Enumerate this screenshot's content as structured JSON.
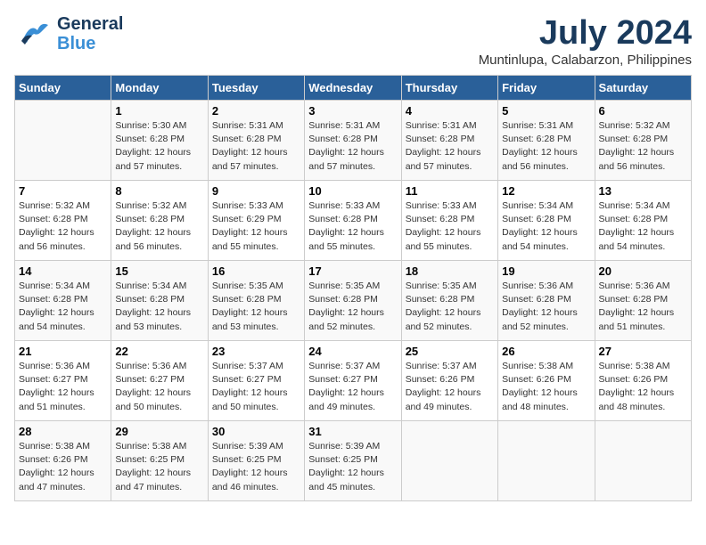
{
  "header": {
    "logo_general": "General",
    "logo_blue": "Blue",
    "main_title": "July 2024",
    "subtitle": "Muntinlupa, Calabarzon, Philippines"
  },
  "days_of_week": [
    "Sunday",
    "Monday",
    "Tuesday",
    "Wednesday",
    "Thursday",
    "Friday",
    "Saturday"
  ],
  "weeks": [
    [
      {
        "day": "",
        "info": ""
      },
      {
        "day": "1",
        "info": "Sunrise: 5:30 AM\nSunset: 6:28 PM\nDaylight: 12 hours\nand 57 minutes."
      },
      {
        "day": "2",
        "info": "Sunrise: 5:31 AM\nSunset: 6:28 PM\nDaylight: 12 hours\nand 57 minutes."
      },
      {
        "day": "3",
        "info": "Sunrise: 5:31 AM\nSunset: 6:28 PM\nDaylight: 12 hours\nand 57 minutes."
      },
      {
        "day": "4",
        "info": "Sunrise: 5:31 AM\nSunset: 6:28 PM\nDaylight: 12 hours\nand 57 minutes."
      },
      {
        "day": "5",
        "info": "Sunrise: 5:31 AM\nSunset: 6:28 PM\nDaylight: 12 hours\nand 56 minutes."
      },
      {
        "day": "6",
        "info": "Sunrise: 5:32 AM\nSunset: 6:28 PM\nDaylight: 12 hours\nand 56 minutes."
      }
    ],
    [
      {
        "day": "7",
        "info": "Sunrise: 5:32 AM\nSunset: 6:28 PM\nDaylight: 12 hours\nand 56 minutes."
      },
      {
        "day": "8",
        "info": "Sunrise: 5:32 AM\nSunset: 6:28 PM\nDaylight: 12 hours\nand 56 minutes."
      },
      {
        "day": "9",
        "info": "Sunrise: 5:33 AM\nSunset: 6:29 PM\nDaylight: 12 hours\nand 55 minutes."
      },
      {
        "day": "10",
        "info": "Sunrise: 5:33 AM\nSunset: 6:28 PM\nDaylight: 12 hours\nand 55 minutes."
      },
      {
        "day": "11",
        "info": "Sunrise: 5:33 AM\nSunset: 6:28 PM\nDaylight: 12 hours\nand 55 minutes."
      },
      {
        "day": "12",
        "info": "Sunrise: 5:34 AM\nSunset: 6:28 PM\nDaylight: 12 hours\nand 54 minutes."
      },
      {
        "day": "13",
        "info": "Sunrise: 5:34 AM\nSunset: 6:28 PM\nDaylight: 12 hours\nand 54 minutes."
      }
    ],
    [
      {
        "day": "14",
        "info": "Sunrise: 5:34 AM\nSunset: 6:28 PM\nDaylight: 12 hours\nand 54 minutes."
      },
      {
        "day": "15",
        "info": "Sunrise: 5:34 AM\nSunset: 6:28 PM\nDaylight: 12 hours\nand 53 minutes."
      },
      {
        "day": "16",
        "info": "Sunrise: 5:35 AM\nSunset: 6:28 PM\nDaylight: 12 hours\nand 53 minutes."
      },
      {
        "day": "17",
        "info": "Sunrise: 5:35 AM\nSunset: 6:28 PM\nDaylight: 12 hours\nand 52 minutes."
      },
      {
        "day": "18",
        "info": "Sunrise: 5:35 AM\nSunset: 6:28 PM\nDaylight: 12 hours\nand 52 minutes."
      },
      {
        "day": "19",
        "info": "Sunrise: 5:36 AM\nSunset: 6:28 PM\nDaylight: 12 hours\nand 52 minutes."
      },
      {
        "day": "20",
        "info": "Sunrise: 5:36 AM\nSunset: 6:28 PM\nDaylight: 12 hours\nand 51 minutes."
      }
    ],
    [
      {
        "day": "21",
        "info": "Sunrise: 5:36 AM\nSunset: 6:27 PM\nDaylight: 12 hours\nand 51 minutes."
      },
      {
        "day": "22",
        "info": "Sunrise: 5:36 AM\nSunset: 6:27 PM\nDaylight: 12 hours\nand 50 minutes."
      },
      {
        "day": "23",
        "info": "Sunrise: 5:37 AM\nSunset: 6:27 PM\nDaylight: 12 hours\nand 50 minutes."
      },
      {
        "day": "24",
        "info": "Sunrise: 5:37 AM\nSunset: 6:27 PM\nDaylight: 12 hours\nand 49 minutes."
      },
      {
        "day": "25",
        "info": "Sunrise: 5:37 AM\nSunset: 6:26 PM\nDaylight: 12 hours\nand 49 minutes."
      },
      {
        "day": "26",
        "info": "Sunrise: 5:38 AM\nSunset: 6:26 PM\nDaylight: 12 hours\nand 48 minutes."
      },
      {
        "day": "27",
        "info": "Sunrise: 5:38 AM\nSunset: 6:26 PM\nDaylight: 12 hours\nand 48 minutes."
      }
    ],
    [
      {
        "day": "28",
        "info": "Sunrise: 5:38 AM\nSunset: 6:26 PM\nDaylight: 12 hours\nand 47 minutes."
      },
      {
        "day": "29",
        "info": "Sunrise: 5:38 AM\nSunset: 6:25 PM\nDaylight: 12 hours\nand 47 minutes."
      },
      {
        "day": "30",
        "info": "Sunrise: 5:39 AM\nSunset: 6:25 PM\nDaylight: 12 hours\nand 46 minutes."
      },
      {
        "day": "31",
        "info": "Sunrise: 5:39 AM\nSunset: 6:25 PM\nDaylight: 12 hours\nand 45 minutes."
      },
      {
        "day": "",
        "info": ""
      },
      {
        "day": "",
        "info": ""
      },
      {
        "day": "",
        "info": ""
      }
    ]
  ]
}
